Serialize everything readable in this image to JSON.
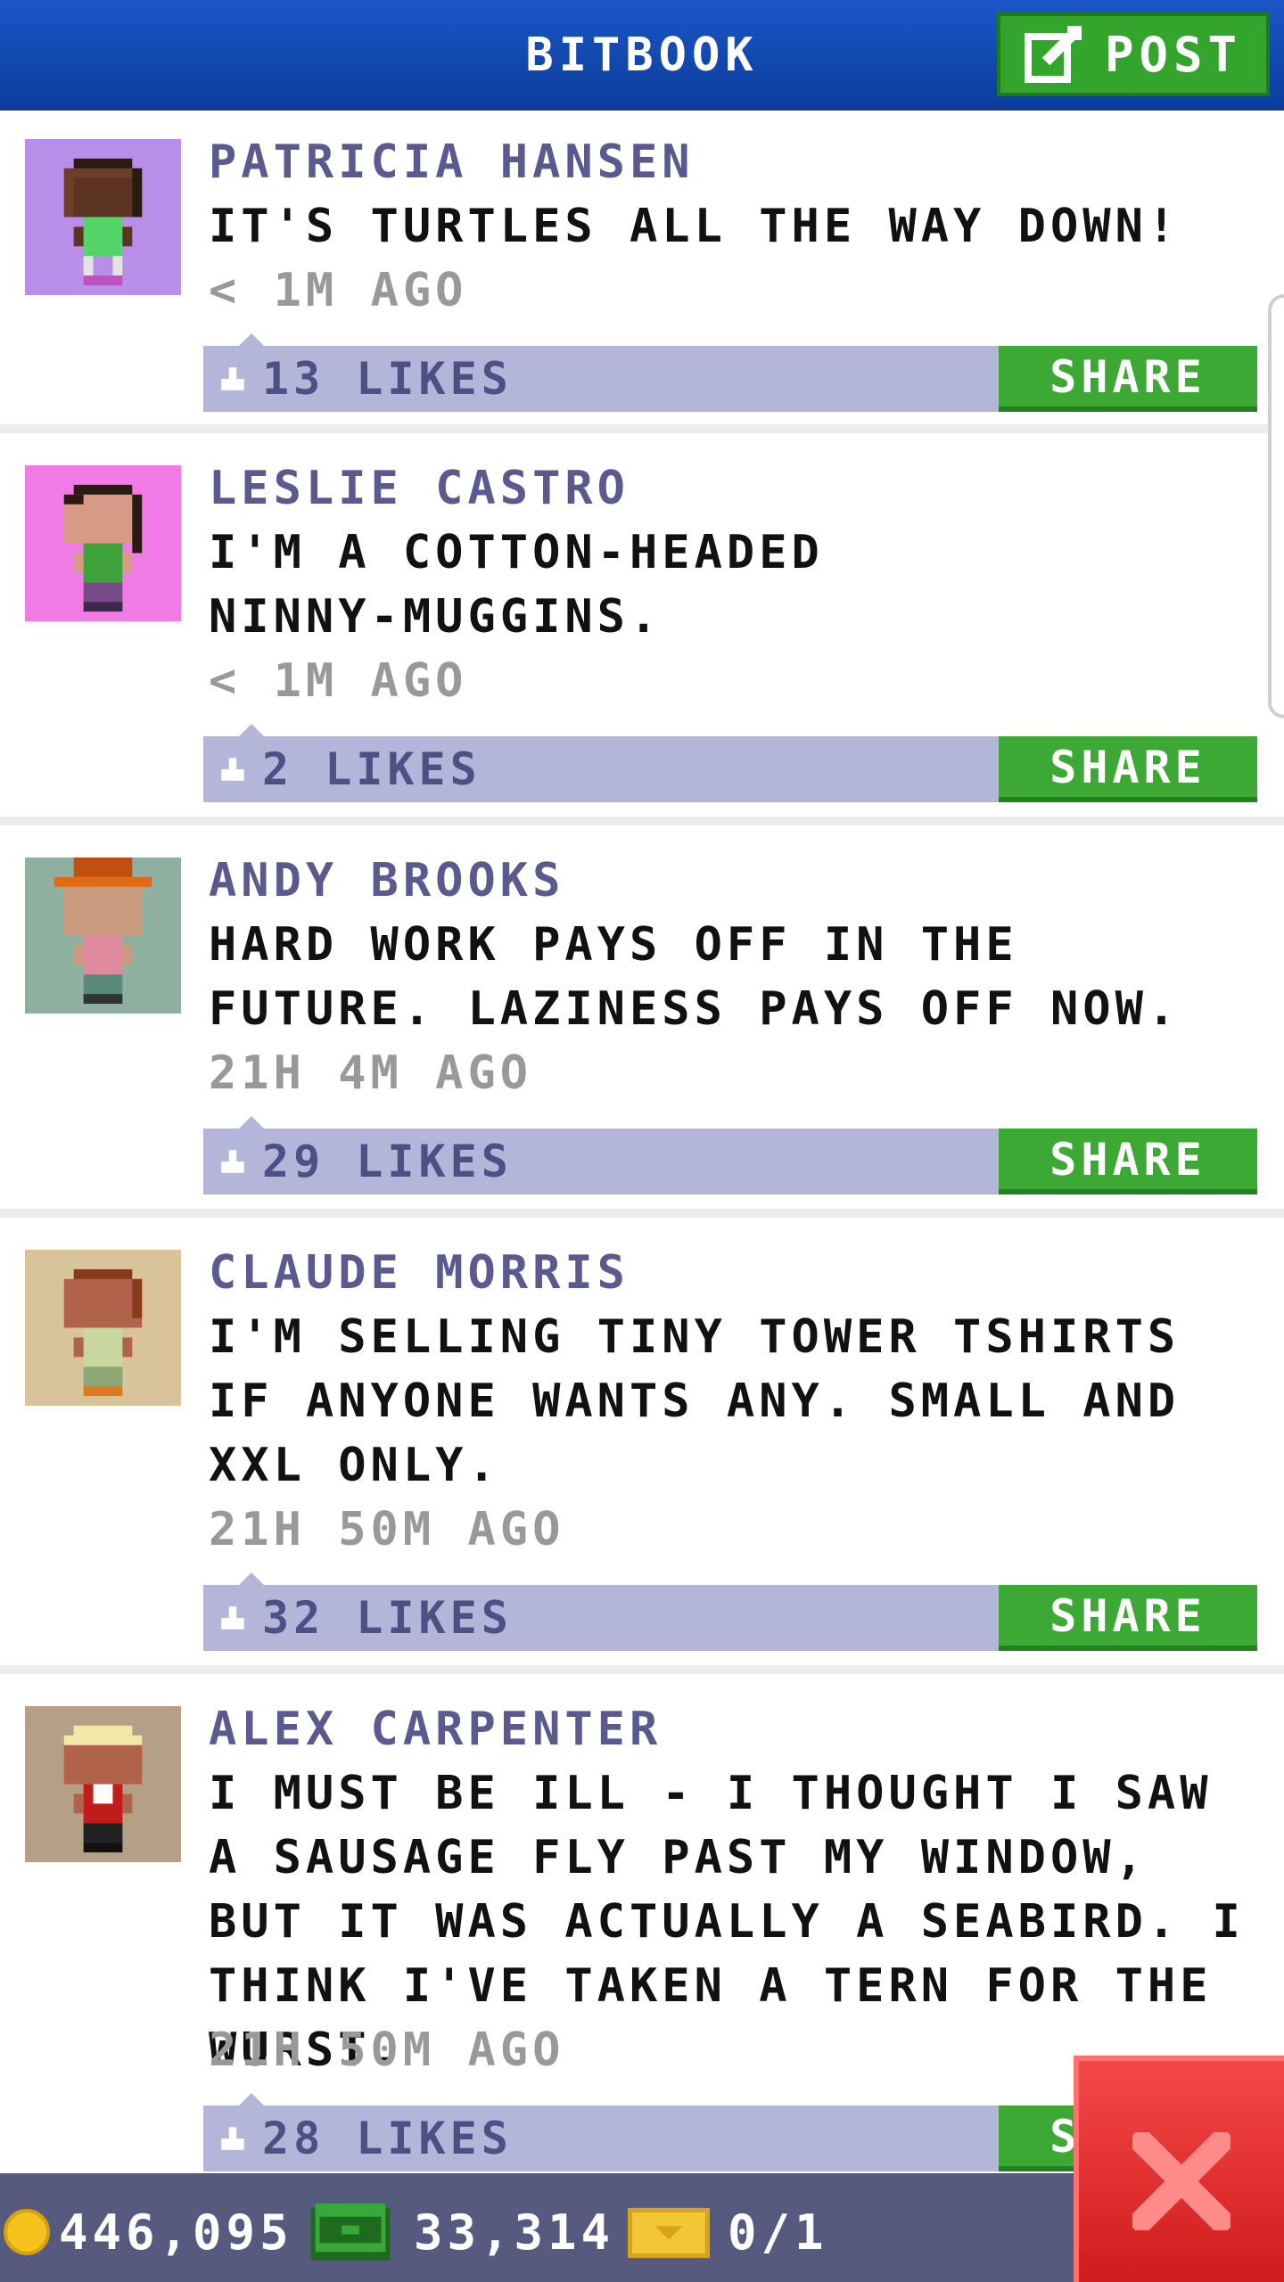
{
  "header": {
    "title": "BITBOOK",
    "post_label": "POST"
  },
  "posts": [
    {
      "author": "PATRICIA HANSEN",
      "message": "IT'S TURTLES ALL THE WAY DOWN!",
      "time": "< 1M AGO",
      "likes": "13 LIKES",
      "share_label": "SHARE",
      "avatar_bg": "#b88ee8"
    },
    {
      "author": "LESLIE CASTRO",
      "message": "I'M A COTTON-HEADED NINNY-MUGGINS.",
      "time": "< 1M AGO",
      "likes": "2 LIKES",
      "share_label": "SHARE",
      "avatar_bg": "#f07ae6"
    },
    {
      "author": "ANDY BROOKS",
      "message": "HARD WORK PAYS OFF IN THE FUTURE. LAZINESS PAYS OFF NOW.",
      "time": "21H 4M AGO",
      "likes": "29 LIKES",
      "share_label": "SHARE",
      "avatar_bg": "#8fb0a0"
    },
    {
      "author": "CLAUDE MORRIS",
      "message": "I'M SELLING TINY TOWER TSHIRTS IF ANYONE WANTS ANY. SMALL AND XXL ONLY.",
      "time": "21H 50M AGO",
      "likes": "32 LIKES",
      "share_label": "SHARE",
      "avatar_bg": "#d8c39a"
    },
    {
      "author": "ALEX CARPENTER",
      "message": "I MUST BE ILL - I THOUGHT I SAW A SAUSAGE FLY PAST MY WINDOW, BUT IT WAS ACTUALLY A SEABIRD. I THINK I'VE TAKEN A TERN FOR THE WURST.",
      "time": "21H 50M AGO",
      "likes": "28 LIKES",
      "share_label": "SHARE",
      "avatar_bg": "#b5a087"
    }
  ],
  "footer": {
    "coins": "446,095",
    "bux": "33,314",
    "tickets": "0/1"
  },
  "colors": {
    "header_blue": "#1b57c8",
    "share_green": "#3da935",
    "likes_bar": "#b3b6d9",
    "author_purple": "#5a5a90",
    "close_red": "#e02a2a"
  }
}
